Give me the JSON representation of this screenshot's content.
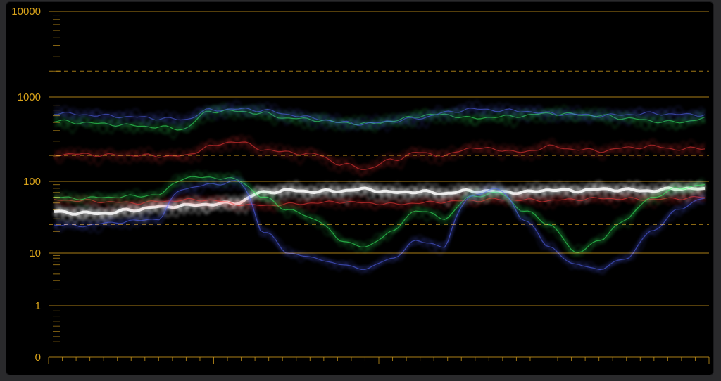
{
  "scope": {
    "type": "waveform",
    "scale": "log-nits",
    "y_tick_labels": [
      "10000",
      "1000",
      "100",
      "10",
      "1",
      "0"
    ],
    "y_tick_values": [
      10000,
      1000,
      100,
      10,
      1,
      0
    ],
    "reference_dashed_levels": [
      2000,
      203,
      25
    ],
    "colors": {
      "background": "#000000",
      "graticule": "#c8951b",
      "label": "#d9a31a",
      "red_trace": "#ff3c3c",
      "green_trace": "#3cff6a",
      "blue_trace": "#5a6bff",
      "white_trace": "#ffffff"
    }
  },
  "chart_data": {
    "type": "line",
    "ylim": [
      0,
      10000
    ],
    "y_scale": "log",
    "title": "",
    "xlabel": "",
    "ylabel": "",
    "grid": true,
    "series": [
      {
        "color": "white",
        "values": [
          38,
          36,
          36,
          40,
          44,
          46,
          48,
          50,
          70,
          75,
          72,
          74,
          78,
          70,
          72,
          68,
          74,
          72,
          70,
          76,
          74,
          78,
          76,
          74,
          80,
          78
        ]
      },
      {
        "color": "green",
        "values": [
          520,
          500,
          480,
          460,
          440,
          420,
          680,
          680,
          640,
          560,
          540,
          500,
          480,
          520,
          600,
          620,
          560,
          580,
          600,
          640,
          620,
          600,
          560,
          520,
          500,
          560
        ]
      },
      {
        "color": "blue",
        "values": [
          650,
          620,
          600,
          580,
          560,
          540,
          700,
          720,
          700,
          620,
          560,
          500,
          480,
          520,
          560,
          650,
          720,
          700,
          680,
          640,
          620,
          600,
          620,
          640,
          620,
          620
        ]
      },
      {
        "color": "red",
        "values": [
          210,
          210,
          205,
          205,
          200,
          200,
          260,
          300,
          240,
          220,
          210,
          160,
          140,
          180,
          220,
          200,
          250,
          240,
          220,
          260,
          240,
          230,
          250,
          260,
          240,
          250
        ]
      },
      {
        "color": "red",
        "values": [
          55,
          54,
          52,
          50,
          52,
          55,
          55,
          48,
          46,
          48,
          50,
          52,
          50,
          48,
          50,
          52,
          54,
          56,
          55,
          54,
          56,
          58,
          57,
          56,
          58,
          60
        ]
      },
      {
        "color": "green",
        "values": [
          60,
          58,
          60,
          62,
          65,
          110,
          112,
          105,
          60,
          40,
          30,
          15,
          12,
          20,
          40,
          30,
          60,
          70,
          40,
          25,
          10,
          15,
          30,
          60,
          80,
          90
        ]
      },
      {
        "color": "blue",
        "values": [
          25,
          24,
          26,
          28,
          30,
          80,
          90,
          100,
          20,
          10,
          8,
          6,
          5,
          8,
          15,
          12,
          60,
          80,
          30,
          12,
          6,
          5,
          8,
          20,
          40,
          60
        ]
      }
    ]
  }
}
